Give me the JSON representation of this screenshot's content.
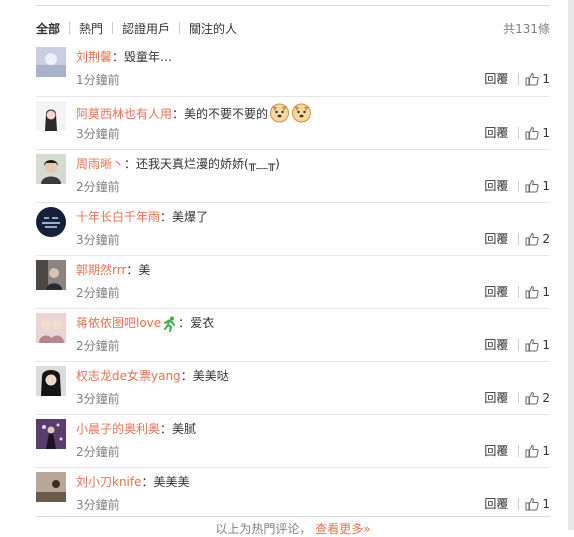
{
  "filters": {
    "tabs": [
      {
        "label": "全部"
      },
      {
        "label": "熱門"
      },
      {
        "label": "認證用戶"
      },
      {
        "label": "關注的人"
      }
    ],
    "total": "共131條"
  },
  "comments": [
    {
      "user": "刘荆馨",
      "text": "毁童年…",
      "time": "1分鐘前",
      "reply": "回覆",
      "likes": "1"
    },
    {
      "user": "阿莫西林也有人用",
      "text": "美的不要不要的",
      "time": "3分鐘前",
      "reply": "回覆",
      "likes": "1"
    },
    {
      "user": "周雨晰丶",
      "text": "还我天真烂漫的娇娇(╥﹏╥)",
      "time": "2分鐘前",
      "reply": "回覆",
      "likes": "1"
    },
    {
      "user": "十年长白千年雨",
      "text": "美爆了",
      "time": "3分鐘前",
      "reply": "回覆",
      "likes": "2"
    },
    {
      "user": "郭期然rrr",
      "text": "美",
      "time": "2分鐘前",
      "reply": "回覆",
      "likes": "1"
    },
    {
      "user": "蒋依依图吧love",
      "text": "爱衣",
      "time": "2分鐘前",
      "reply": "回覆",
      "likes": "1"
    },
    {
      "user": "权志龙de女票yang",
      "text": "美美哒",
      "time": "3分鐘前",
      "reply": "回覆",
      "likes": "2"
    },
    {
      "user": "小晨子的奥利奥",
      "text": "美腻",
      "time": "2分鐘前",
      "reply": "回覆",
      "likes": "1"
    },
    {
      "user": "刘小刀knife",
      "text": "美美美",
      "time": "3分鐘前",
      "reply": "回覆",
      "likes": "1"
    }
  ],
  "footer": {
    "text": "以上为热門评论，",
    "more": "查看更多»"
  },
  "colors": {
    "username": "#eb7350",
    "time": "#808080",
    "divider": "#e6e6e6"
  }
}
